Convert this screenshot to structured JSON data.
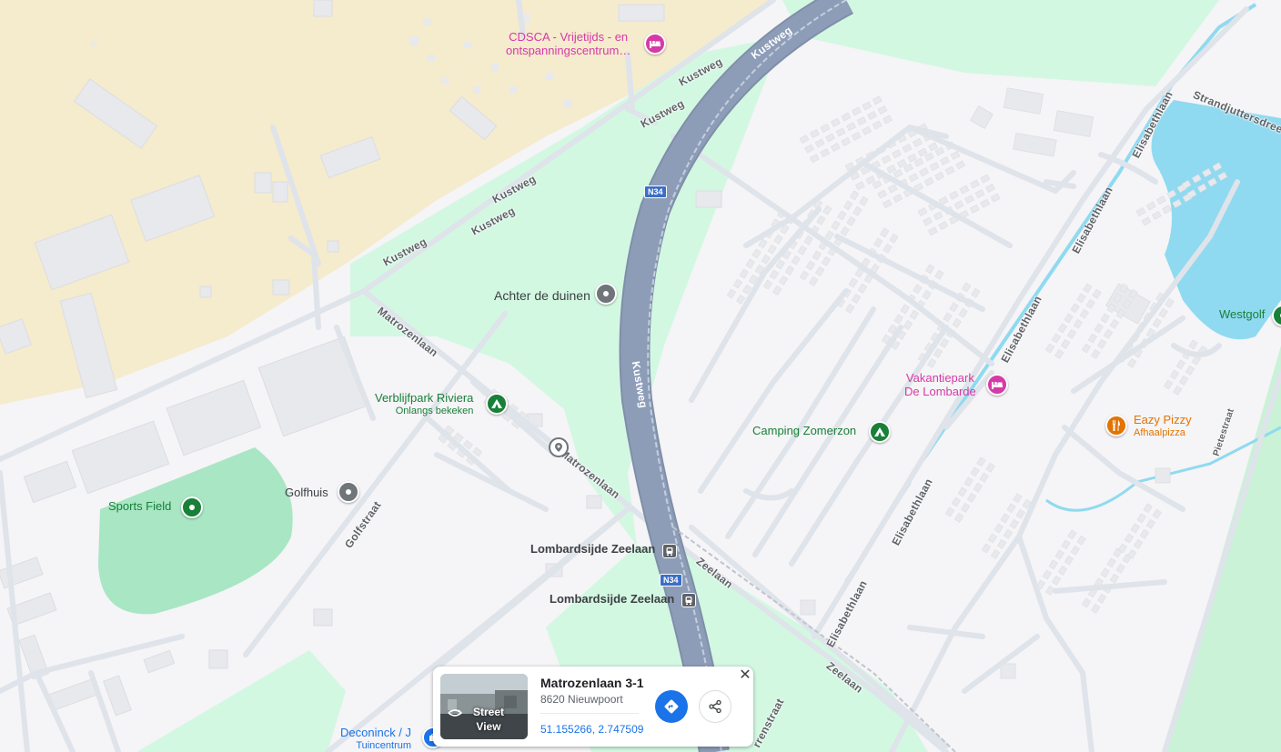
{
  "map": {
    "colors": {
      "background": "#f5f4f6",
      "sand": "#f5ebcd",
      "green_area": "#d3f8e2",
      "park_field": "#a8e6c4",
      "water": "#8fdaf0",
      "highway": "#8d9db8",
      "road": "#dfe3ea",
      "accent_blue": "#1a73e8"
    },
    "pois": [
      {
        "id": "cdsca",
        "name_line1": "CDSCA - Vrijetijds - en",
        "name_line2": "ontspanningscentrum…",
        "icon": "bed-icon",
        "color": "#d63aa7"
      },
      {
        "id": "achter",
        "name": "Achter de duinen",
        "icon": "place-icon",
        "color": "#5f6368"
      },
      {
        "id": "riviera",
        "name": "Verblijfpark Riviera",
        "subtitle": "Onlangs bekeken",
        "icon": "camping-icon",
        "color": "#188038"
      },
      {
        "id": "sports",
        "name": "Sports Field",
        "icon": "park-icon",
        "color": "#188038"
      },
      {
        "id": "golfhuis",
        "name": "Golfhuis",
        "icon": "place-icon",
        "color": "#5f6368"
      },
      {
        "id": "zomerzon",
        "name": "Camping Zomerzon",
        "icon": "camping-icon",
        "color": "#188038"
      },
      {
        "id": "lombarde",
        "name_line1": "Vakantiepark",
        "name_line2": "De Lombarde",
        "icon": "bed-icon",
        "color": "#d63aa7"
      },
      {
        "id": "eazy",
        "name": "Eazy Pizzy",
        "subtitle": "Afhaalpizza",
        "icon": "restaurant-icon",
        "color": "#e37400"
      },
      {
        "id": "westgolf",
        "name": "Westgolf",
        "icon": "park-icon",
        "color": "#188038"
      },
      {
        "id": "zeelaan1",
        "name": "Lombardsijde Zeelaan",
        "icon": "tram-icon",
        "color": "#3c4043"
      },
      {
        "id": "zeelaan2",
        "name": "Lombardsijde Zeelaan",
        "icon": "tram-icon",
        "color": "#3c4043"
      },
      {
        "id": "deconinck",
        "name": "Deconinck / J",
        "subtitle": "Tuincentrum",
        "icon": "shop-icon",
        "color": "#1a73e8"
      }
    ],
    "streets": {
      "kustweg": "Kustweg",
      "matrozenlaan": "Matrozenlaan",
      "golfstraat": "Golfstraat",
      "zeelaan": "Zeelaan",
      "elisabethlaan": "Elisabethlaan",
      "strandjuttersdreef": "Strandjuttersdreef",
      "pietestraat": "Pietestraat",
      "bottom_street": "rrenstraat"
    },
    "route_shield": "N34"
  },
  "card": {
    "title": "Matrozenlaan 3-1",
    "address": "8620 Nieuwpoort",
    "coordinates": "51.155266, 2.747509",
    "street_view_label_line1": "Street",
    "street_view_label_line2": "View",
    "close_label": "✕"
  }
}
